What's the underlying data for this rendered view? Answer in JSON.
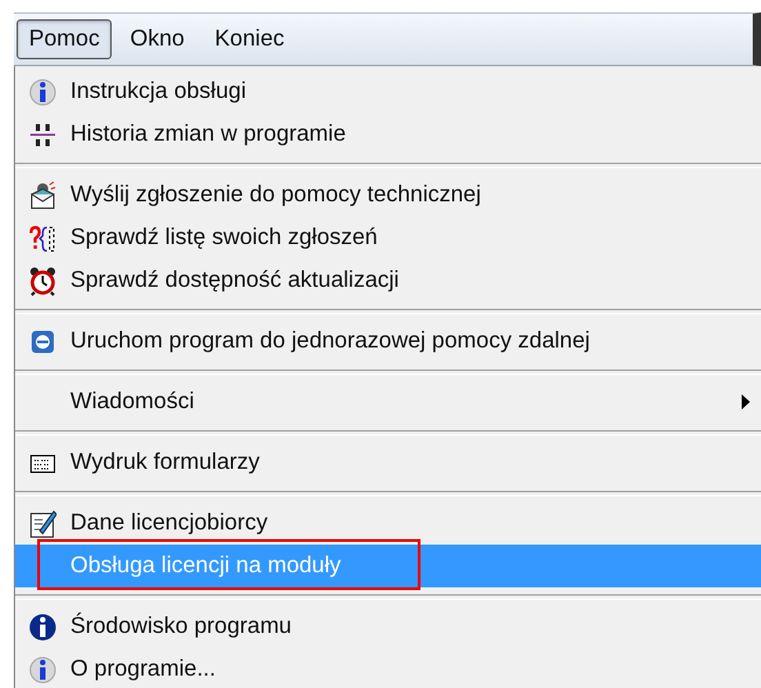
{
  "menu_bar": [
    {
      "label": "Pomoc",
      "selected": true
    },
    {
      "label": "Okno",
      "selected": false
    },
    {
      "label": "Koniec",
      "selected": false
    }
  ],
  "menu": [
    {
      "kind": "item",
      "label": "Instrukcja obsługi",
      "selected": false
    },
    {
      "kind": "item",
      "label": "Historia zmian w programie",
      "selected": false
    },
    {
      "kind": "separator"
    },
    {
      "kind": "item",
      "label": "Wyślij zgłoszenie do pomocy technicznej",
      "selected": false
    },
    {
      "kind": "item",
      "label": "Sprawdź listę swoich zgłoszeń",
      "selected": false
    },
    {
      "kind": "item",
      "label": "Sprawdź dostępność aktualizacji",
      "selected": false
    },
    {
      "kind": "separator"
    },
    {
      "kind": "item",
      "label": "Uruchom program do jednorazowej pomocy zdalnej",
      "selected": false
    },
    {
      "kind": "separator"
    },
    {
      "kind": "submenu",
      "label": "Wiadomości",
      "selected": false
    },
    {
      "kind": "separator"
    },
    {
      "kind": "item",
      "label": "Wydruk formularzy",
      "selected": false
    },
    {
      "kind": "separator"
    },
    {
      "kind": "item",
      "label": "Dane licencjobiorcy",
      "selected": false
    },
    {
      "kind": "item",
      "label": "Obsługa licencji na moduły",
      "selected": true,
      "annotated": true
    },
    {
      "kind": "separator"
    },
    {
      "kind": "item",
      "label": "Środowisko programu",
      "selected": false
    },
    {
      "kind": "item",
      "label": "O programie...",
      "selected": false
    }
  ]
}
